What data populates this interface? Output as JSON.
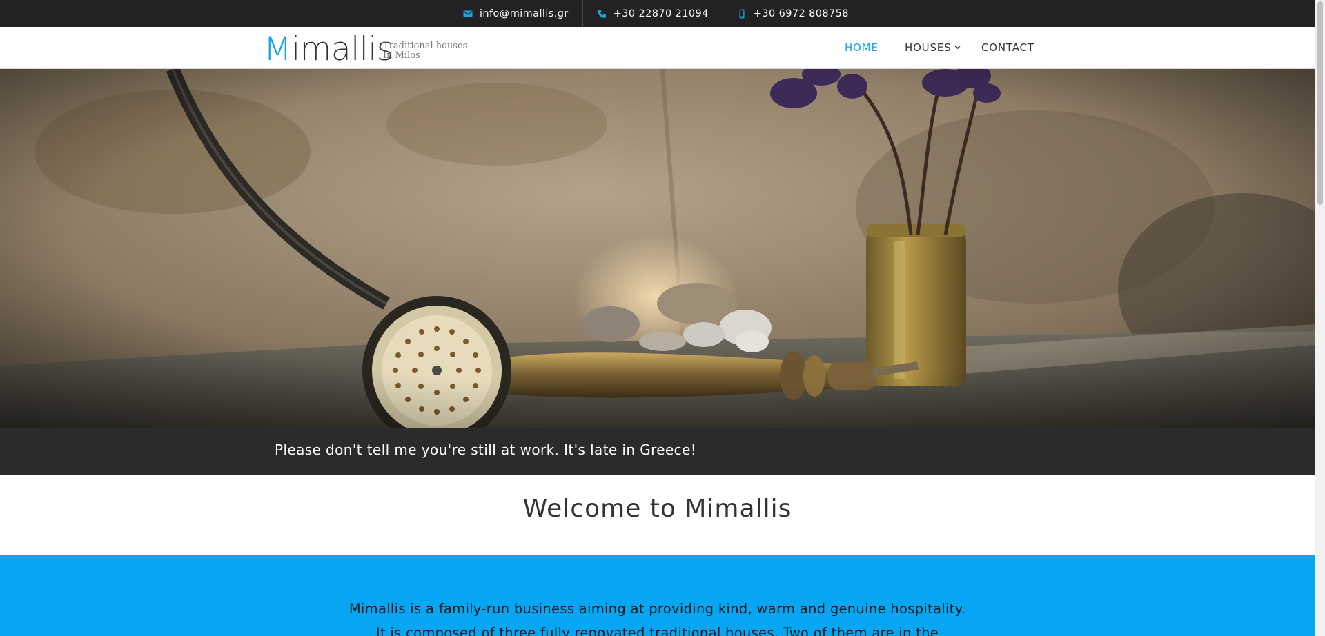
{
  "topbar": {
    "email": "info@mimallis.gr",
    "phone": "+30 22870 21094",
    "mobile": "+30 6972 808758",
    "icons": {
      "email": "envelope-icon",
      "phone": "phone-icon",
      "mobile": "mobile-icon"
    }
  },
  "header": {
    "logo_initial": "M",
    "logo_rest": "imallis",
    "tagline_line1": "Traditional houses",
    "tagline_line2": "In Milos"
  },
  "nav": {
    "home": "HOME",
    "houses": "HOUSES",
    "contact": "CONTACT",
    "active": "home"
  },
  "hero": {
    "image_alt": "Brass hand shower on stone ledge with vase of purple flowers"
  },
  "quote": {
    "text": "Please don't tell me you're still at work. It's late in Greece!"
  },
  "welcome": {
    "title": "Welcome to Mimallis"
  },
  "intro": {
    "line1": "Mimallis is a family-run business aiming at providing kind, warm and genuine hospitality.",
    "line2": "It is composed of three fully renovated traditional houses. Two of them are in the"
  },
  "colors": {
    "accent": "#1aa3e8",
    "topbar_bg": "#222222",
    "quote_bg": "#2b2b2b",
    "intro_bg": "#07a6f3"
  }
}
